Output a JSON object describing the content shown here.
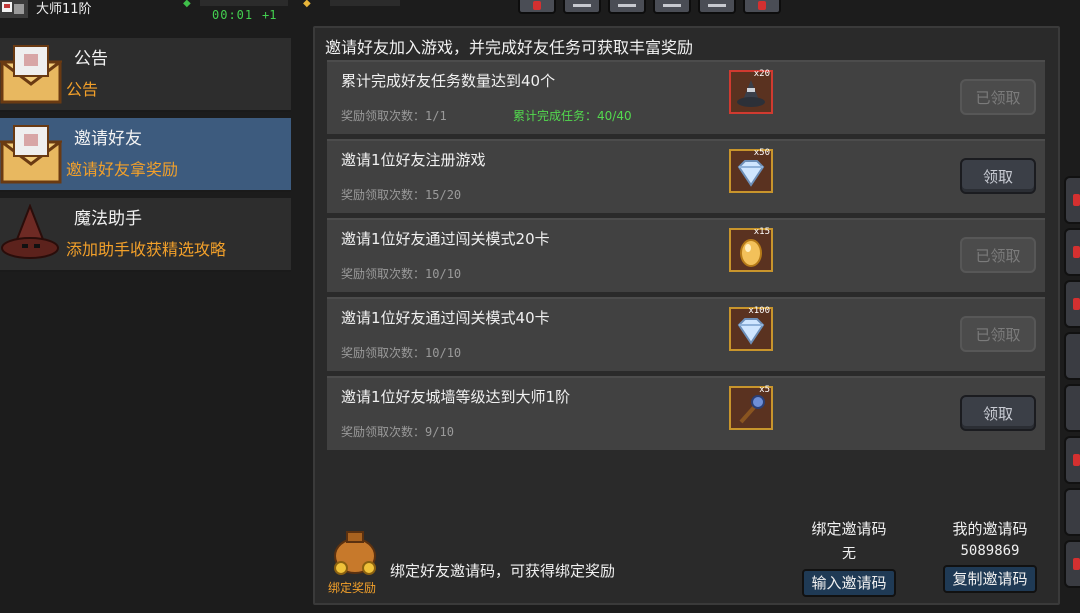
{
  "hud": {
    "rank": "大师11阶",
    "timer": "00:01",
    "bonus": "+1",
    "buttons": [
      {
        "icon": "alert-icon",
        "alert": true
      },
      {
        "icon": "bar-icon",
        "alert": false
      },
      {
        "icon": "bar-icon",
        "alert": false
      },
      {
        "icon": "bar-icon",
        "alert": false
      },
      {
        "icon": "bar-icon",
        "alert": false
      },
      {
        "icon": "alert-icon",
        "alert": true
      }
    ]
  },
  "menu": [
    {
      "title": "公告",
      "subtitle": "公告",
      "icon": "envelope-icon",
      "active": false
    },
    {
      "title": "邀请好友",
      "subtitle": "邀请好友拿奖励",
      "icon": "envelope-icon",
      "active": true
    },
    {
      "title": "魔法助手",
      "subtitle": "添加助手收获精选攻略",
      "icon": "wizard-hat-icon",
      "active": false
    }
  ],
  "panel": {
    "header": "邀请好友加入游戏，并完成好友任务可获取丰富奖励",
    "count_label": "奖励领取次数：",
    "tasks": [
      {
        "title": "累计完成好友任务数量达到40个",
        "count": "1/1",
        "extra": "累计完成任务：40/40",
        "reward_icon": "hat-icon",
        "reward_qty": "x20",
        "button": "已领取",
        "claimed": true
      },
      {
        "title": "邀请1位好友注册游戏",
        "count": "15/20",
        "extra": "",
        "reward_icon": "diamond-icon",
        "reward_qty": "x50",
        "button": "领取",
        "claimed": false
      },
      {
        "title": "邀请1位好友通过闯关模式20卡",
        "count": "10/10",
        "extra": "",
        "reward_icon": "gold-egg-icon",
        "reward_qty": "x15",
        "button": "已领取",
        "claimed": true
      },
      {
        "title": "邀请1位好友通过闯关模式40卡",
        "count": "10/10",
        "extra": "",
        "reward_icon": "diamond-icon",
        "reward_qty": "x100",
        "button": "已领取",
        "claimed": true
      },
      {
        "title": "邀请1位好友城墙等级达到大师1阶",
        "count": "9/10",
        "extra": "",
        "reward_icon": "staff-icon",
        "reward_qty": "x5",
        "button": "领取",
        "claimed": false
      }
    ]
  },
  "footer": {
    "bag_label": "绑定奖励",
    "description": "绑定好友邀请码，可获得绑定奖励",
    "bind_code_label": "绑定邀请码",
    "bind_code_value": "无",
    "bind_button": "输入邀请码",
    "my_code_label": "我的邀请码",
    "my_code_value": "5089869",
    "copy_button": "复制邀请码"
  },
  "colors": {
    "accent_orange": "#f2a02a",
    "progress_green": "#53d94e",
    "active_menu": "#3d5b7e"
  }
}
